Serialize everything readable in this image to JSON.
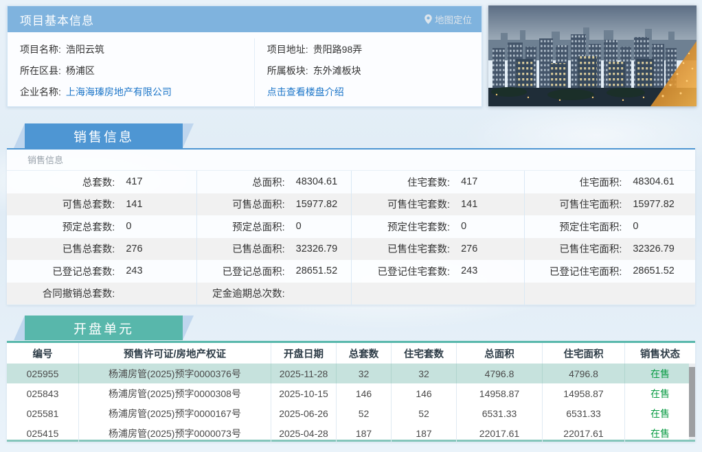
{
  "colors": {
    "header_blue": "#7fb3de",
    "tab_blue": "#4e96d3",
    "tab_teal": "#58b7ab",
    "selected_row": "#c6e2dd",
    "status_green": "#089b43",
    "link_blue": "#1b75c8"
  },
  "project": {
    "title": "项目基本信息",
    "map_link": "地图定位",
    "name_label": "项目名称:",
    "name_value": "浩阳云筑",
    "address_label": "项目地址:",
    "address_value": "贵阳路98弄",
    "district_label": "所在区县:",
    "district_value": "杨浦区",
    "plate_label": "所属板块:",
    "plate_value": "东外滩板块",
    "company_label": "企业名称:",
    "company_value": "上海海瑧房地产有限公司",
    "intro_link": "点击查看楼盘介绍"
  },
  "sales": {
    "tab_label": "销售信息",
    "sub_label": "销售信息",
    "rows": [
      {
        "cells": [
          {
            "label": "总套数:",
            "value": "417"
          },
          {
            "label": "总面积:",
            "value": "48304.61"
          },
          {
            "label": "住宅套数:",
            "value": "417"
          },
          {
            "label": "住宅面积:",
            "value": "48304.61"
          }
        ]
      },
      {
        "cells": [
          {
            "label": "可售总套数:",
            "value": "141"
          },
          {
            "label": "可售总面积:",
            "value": "15977.82"
          },
          {
            "label": "可售住宅套数:",
            "value": "141"
          },
          {
            "label": "可售住宅面积:",
            "value": "15977.82"
          }
        ]
      },
      {
        "cells": [
          {
            "label": "预定总套数:",
            "value": "0"
          },
          {
            "label": "预定总面积:",
            "value": "0"
          },
          {
            "label": "预定住宅套数:",
            "value": "0"
          },
          {
            "label": "预定住宅面积:",
            "value": "0"
          }
        ]
      },
      {
        "cells": [
          {
            "label": "已售总套数:",
            "value": "276"
          },
          {
            "label": "已售总面积:",
            "value": "32326.79"
          },
          {
            "label": "已售住宅套数:",
            "value": "276"
          },
          {
            "label": "已售住宅面积:",
            "value": "32326.79"
          }
        ]
      },
      {
        "cells": [
          {
            "label": "已登记总套数:",
            "value": "243"
          },
          {
            "label": "已登记总面积:",
            "value": "28651.52"
          },
          {
            "label": "已登记住宅套数:",
            "value": "243"
          },
          {
            "label": "已登记住宅面积:",
            "value": "28651.52"
          }
        ]
      },
      {
        "cells": [
          {
            "label": "合同撤销总套数:",
            "value": ""
          },
          {
            "label": "定金逾期总次数:",
            "value": ""
          },
          {
            "label": "",
            "value": ""
          },
          {
            "label": "",
            "value": ""
          }
        ]
      }
    ]
  },
  "kaipan": {
    "tab_label": "开盘单元",
    "columns": [
      "编号",
      "预售许可证/房地产权证",
      "开盘日期",
      "总套数",
      "住宅套数",
      "总面积",
      "住宅面积",
      "销售状态"
    ],
    "rows": [
      {
        "selected": true,
        "cells": [
          "025955",
          "杨浦房管(2025)预字0000376号",
          "2025-11-28",
          "32",
          "32",
          "4796.8",
          "4796.8"
        ],
        "status": "在售"
      },
      {
        "selected": false,
        "cells": [
          "025843",
          "杨浦房管(2025)预字0000308号",
          "2025-10-15",
          "146",
          "146",
          "14958.87",
          "14958.87"
        ],
        "status": "在售"
      },
      {
        "selected": false,
        "cells": [
          "025581",
          "杨浦房管(2025)预字0000167号",
          "2025-06-26",
          "52",
          "52",
          "6531.33",
          "6531.33"
        ],
        "status": "在售"
      },
      {
        "selected": false,
        "cells": [
          "025415",
          "杨浦房管(2025)预字0000073号",
          "2025-04-28",
          "187",
          "187",
          "22017.61",
          "22017.61"
        ],
        "status": "在售"
      }
    ]
  }
}
